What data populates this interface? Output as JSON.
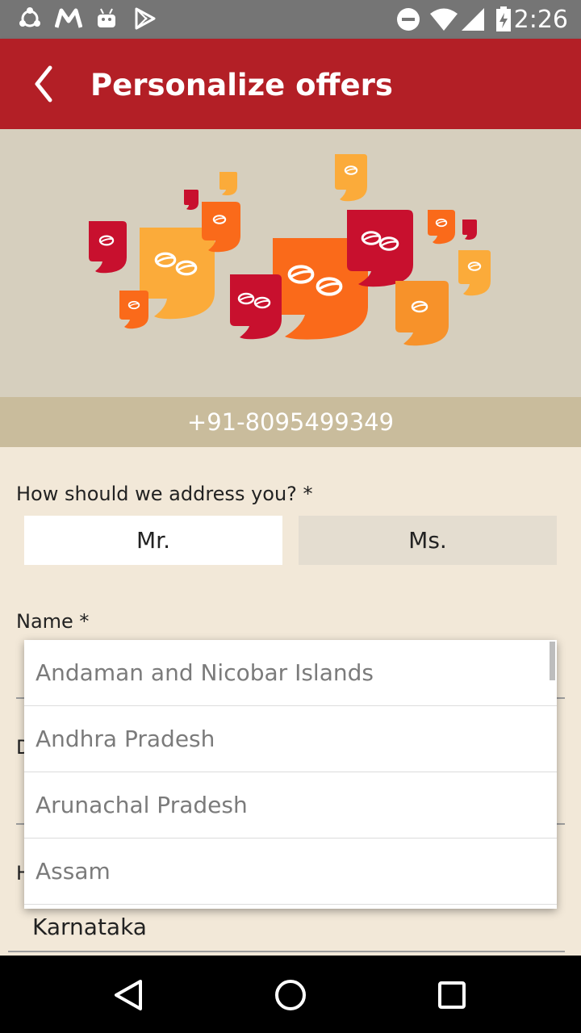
{
  "status_bar": {
    "time": "2:26",
    "left_icons": [
      "sync-icon",
      "m-app-icon",
      "android-icon",
      "play-store-icon"
    ],
    "right_icons": [
      "do-not-disturb-icon",
      "wifi-icon",
      "signal-icon",
      "battery-icon"
    ]
  },
  "app_bar": {
    "title": "Personalize offers",
    "back_icon": "chevron-left-icon",
    "color": "#b31f26"
  },
  "banner": {
    "icon": "coffee-quote-bubbles-illustration",
    "colors": [
      "#c8102e",
      "#fa6a1a",
      "#fbab3a",
      "#f7842a"
    ]
  },
  "phone": "+91-8095499349",
  "form": {
    "address_label": "How should we address you? *",
    "salutation_options": [
      "Mr.",
      "Ms."
    ],
    "selected_salutation": "Mr.",
    "name_label": "Name *",
    "field_d_label_fragment": "D",
    "field_h_label_fragment": "H",
    "state_value": "Karnataka"
  },
  "dropdown": {
    "items": [
      "Andaman and Nicobar Islands",
      "Andhra Pradesh",
      "Arunachal Pradesh",
      "Assam"
    ]
  },
  "nav_bar": {
    "buttons": [
      "back-icon",
      "home-icon",
      "recents-icon"
    ]
  }
}
